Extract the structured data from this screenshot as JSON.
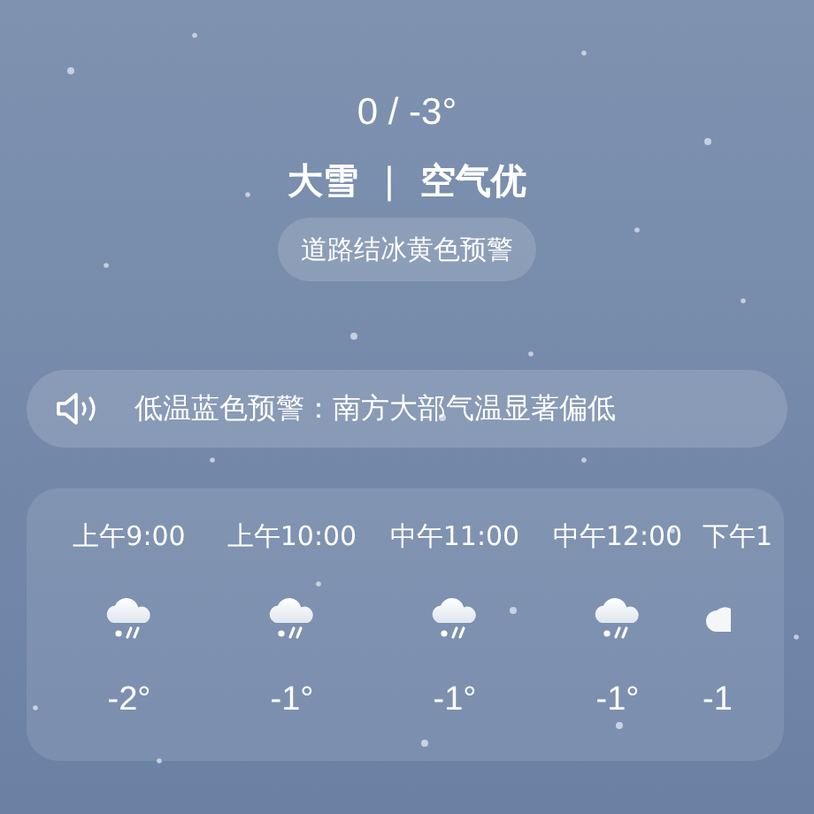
{
  "current": {
    "range": "0 / -3°",
    "condition": "大雪",
    "separator": "|",
    "air_quality": "空气优",
    "warning": "道路结冰黄色预警"
  },
  "alert": {
    "text": "低温蓝色预警：南方大部气温显著偏低"
  },
  "hourly": [
    {
      "time": "上午9:00",
      "kind": "snow",
      "temp": "-2°"
    },
    {
      "time": "上午10:00",
      "kind": "snow",
      "temp": "-1°"
    },
    {
      "time": "中午11:00",
      "kind": "snow",
      "temp": "-1°"
    },
    {
      "time": "中午12:00",
      "kind": "snow",
      "temp": "-1°"
    },
    {
      "time": "下午1",
      "kind": "cloud",
      "temp": "-1"
    }
  ]
}
